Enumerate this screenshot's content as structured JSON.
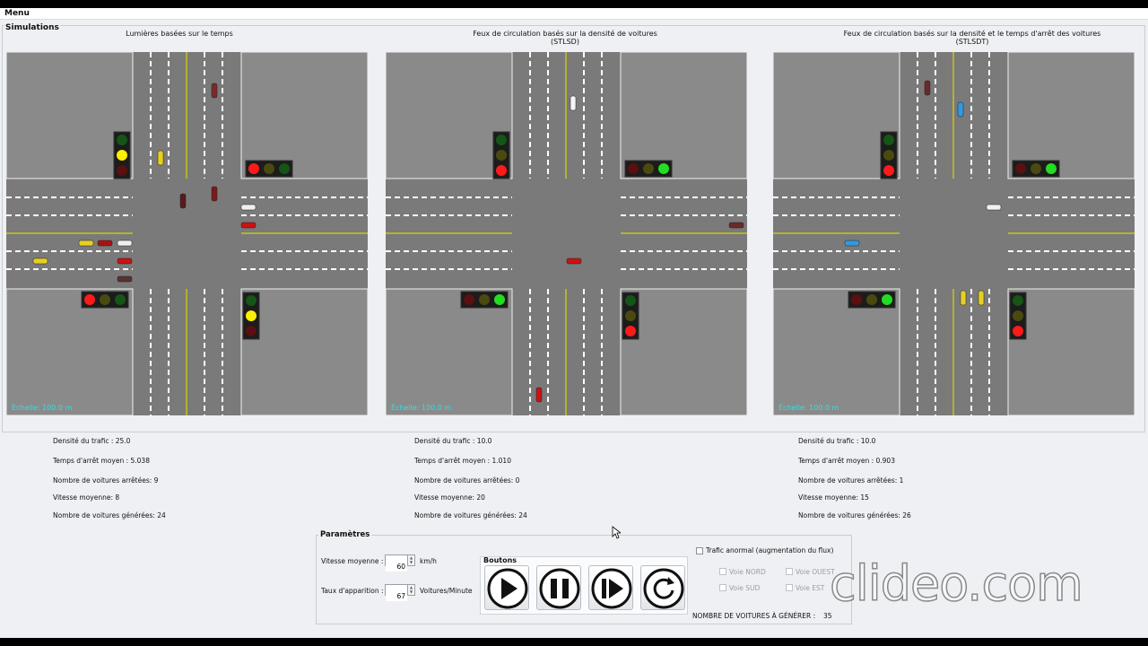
{
  "menu": {
    "label": "Menu"
  },
  "simulations": {
    "legend": "Simulations",
    "panels": [
      {
        "title_line1": "Lumières basées sur le temps",
        "title_line2": "",
        "scale": "Échelle: 100.0 m",
        "lights": {
          "nw": "yellow",
          "ne": "red",
          "sw": "red",
          "se": "yellow"
        }
      },
      {
        "title_line1": "Feux de circulation basés sur la densité de voitures",
        "title_line2": "(STLSD)",
        "scale": "Échelle: 100.0 m",
        "lights": {
          "nw": "red",
          "ne": "green",
          "sw": "green",
          "se": "red"
        }
      },
      {
        "title_line1": "Feux de circulation basés sur la densité et le temps d'arrêt des voitures",
        "title_line2": "(STLSDT)",
        "scale": "Échelle: 100.0 m",
        "lights": {
          "nw": "red",
          "ne": "green",
          "sw": "green",
          "se": "red"
        }
      }
    ]
  },
  "stats": [
    {
      "density": "Densité du trafic : 25.0",
      "avg_stop": "Temps d'arrêt moyen : 5.038",
      "stopped": "Nombre de voitures arrêtées: 9",
      "avg_speed": "Vitesse moyenne: 8",
      "generated": "Nombre de voitures générées: 24"
    },
    {
      "density": "Densité du trafic : 10.0",
      "avg_stop": "Temps d'arrêt moyen : 1.010",
      "stopped": "Nombre de voitures arrêtées: 0",
      "avg_speed": "Vitesse moyenne: 20",
      "generated": "Nombre de voitures générées: 24"
    },
    {
      "density": "Densité du trafic : 10.0",
      "avg_stop": "Temps d'arrêt moyen : 0.903",
      "stopped": "Nombre de voitures arrêtées: 1",
      "avg_speed": "Vitesse moyenne: 15",
      "generated": "Nombre de voitures générées: 26"
    }
  ],
  "params": {
    "legend": "Paramètres",
    "speed_label": "Vitesse moyenne :",
    "speed_value": "60",
    "speed_unit": "km/h",
    "rate_label": "Taux d'apparition :",
    "rate_value": "67",
    "rate_unit": "Voitures/Minute",
    "buttons_label": "Boutons",
    "abnormal_label": "Trafic anormal (augmentation du flux)",
    "lanes": {
      "north": "Voie NORD",
      "west": "Voie OUEST",
      "south": "Voie SUD",
      "east": "Voie EST"
    },
    "to_generate_label": "NOMBRE DE VOITURES À GÉNÉRER :",
    "to_generate_value": "35"
  },
  "watermark": "clideo.com",
  "colors": {
    "road": "#7a7a7a",
    "grass": "#8a8a8a",
    "center_line": "#d8d800",
    "scale_text": "#33e0e0",
    "light_housing": "#202020"
  }
}
